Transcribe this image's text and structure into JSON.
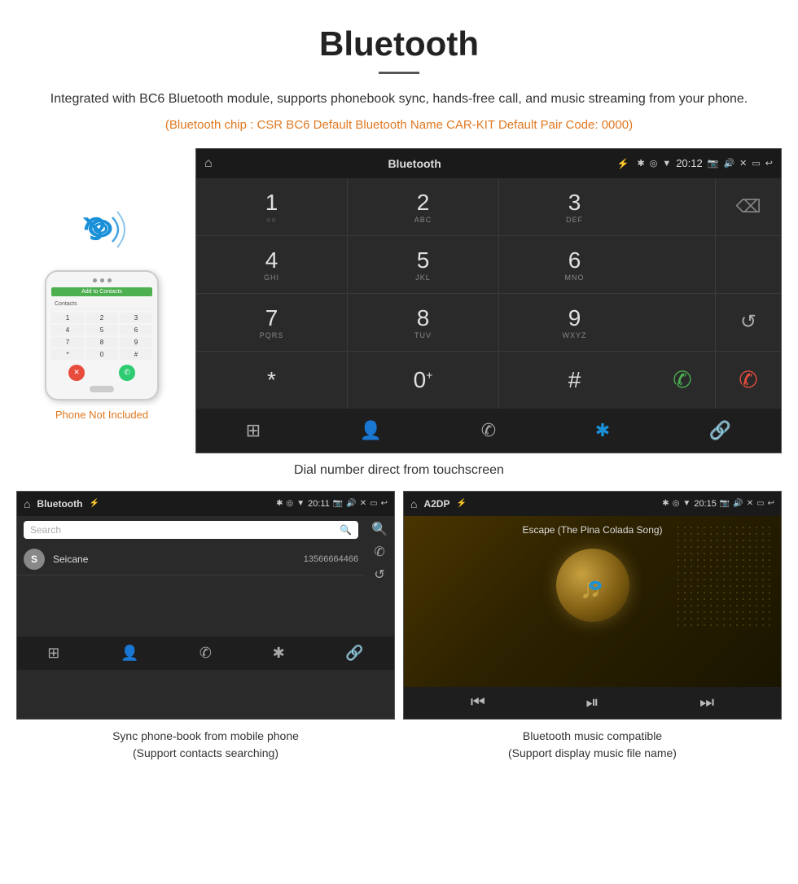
{
  "header": {
    "title": "Bluetooth",
    "description": "Integrated with BC6 Bluetooth module, supports phonebook sync, hands-free call, and music streaming from your phone.",
    "specs": "(Bluetooth chip : CSR BC6    Default Bluetooth Name CAR-KIT    Default Pair Code: 0000)"
  },
  "phone_label": "Phone Not Included",
  "dial_screen": {
    "title": "Bluetooth",
    "time": "20:12",
    "keys": [
      {
        "num": "1",
        "sub": "○○"
      },
      {
        "num": "2",
        "sub": "ABC"
      },
      {
        "num": "3",
        "sub": "DEF"
      },
      {
        "num": "4",
        "sub": "GHI"
      },
      {
        "num": "5",
        "sub": "JKL"
      },
      {
        "num": "6",
        "sub": "MNO"
      },
      {
        "num": "7",
        "sub": "PQRS"
      },
      {
        "num": "8",
        "sub": "TUV"
      },
      {
        "num": "9",
        "sub": "WXYZ"
      },
      {
        "num": "*",
        "sub": ""
      },
      {
        "num": "0",
        "sub": "+"
      },
      {
        "num": "#",
        "sub": ""
      }
    ],
    "bottom_icons": [
      "grid",
      "person",
      "phone",
      "bluetooth",
      "link"
    ]
  },
  "caption_dial": "Dial number direct from touchscreen",
  "phonebook_screen": {
    "title": "Bluetooth",
    "time": "20:11",
    "search_placeholder": "Search",
    "contacts": [
      {
        "initial": "S",
        "name": "Seicane",
        "number": "13566664466"
      }
    ],
    "bottom_icons": [
      "grid",
      "person",
      "phone",
      "bluetooth",
      "link"
    ]
  },
  "caption_phonebook": "Sync phone-book from mobile phone\n(Support contacts searching)",
  "music_screen": {
    "title": "A2DP",
    "time": "20:15",
    "song_title": "Escape (The Pina Colada Song)"
  },
  "caption_music": "Bluetooth music compatible\n(Support display music file name)"
}
